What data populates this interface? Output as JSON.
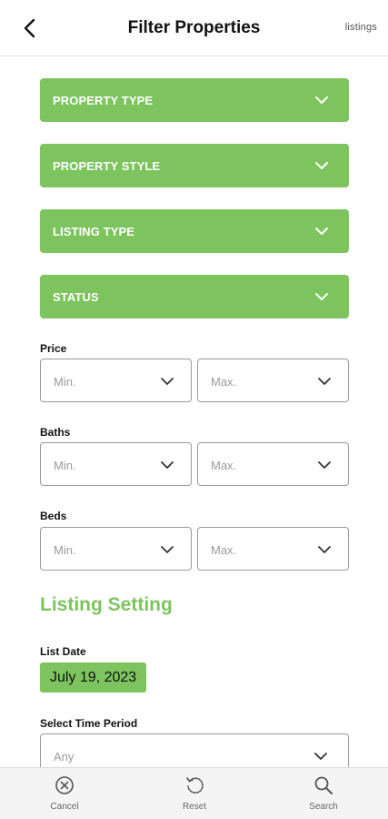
{
  "header": {
    "title": "Filter Properties",
    "brand": "listings",
    "back_icon": "back-arrow-icon"
  },
  "accordions": [
    {
      "label": "PROPERTY TYPE"
    },
    {
      "label": "PROPERTY STYLE"
    },
    {
      "label": "LISTING TYPE"
    },
    {
      "label": "STATUS"
    }
  ],
  "price": {
    "label": "Price",
    "min_placeholder": "Min.",
    "max_placeholder": "Max."
  },
  "baths": {
    "label": "Baths",
    "min_placeholder": "Min.",
    "max_placeholder": "Max."
  },
  "beds": {
    "label": "Beds",
    "min_placeholder": "Min.",
    "max_placeholder": "Max."
  },
  "listing_setting": {
    "heading": "Listing Setting",
    "list_date_label": "List Date",
    "list_date_value": "July 19, 2023",
    "time_period_label": "Select Time Period",
    "time_period_value": "Any"
  },
  "bottom_bar": {
    "cancel": "Cancel",
    "reset": "Reset",
    "search": "Search"
  },
  "colors": {
    "accent_green": "#7dc45f",
    "border_gray": "#9a9a9a",
    "bottom_bar_bg": "#f4f4f4"
  }
}
